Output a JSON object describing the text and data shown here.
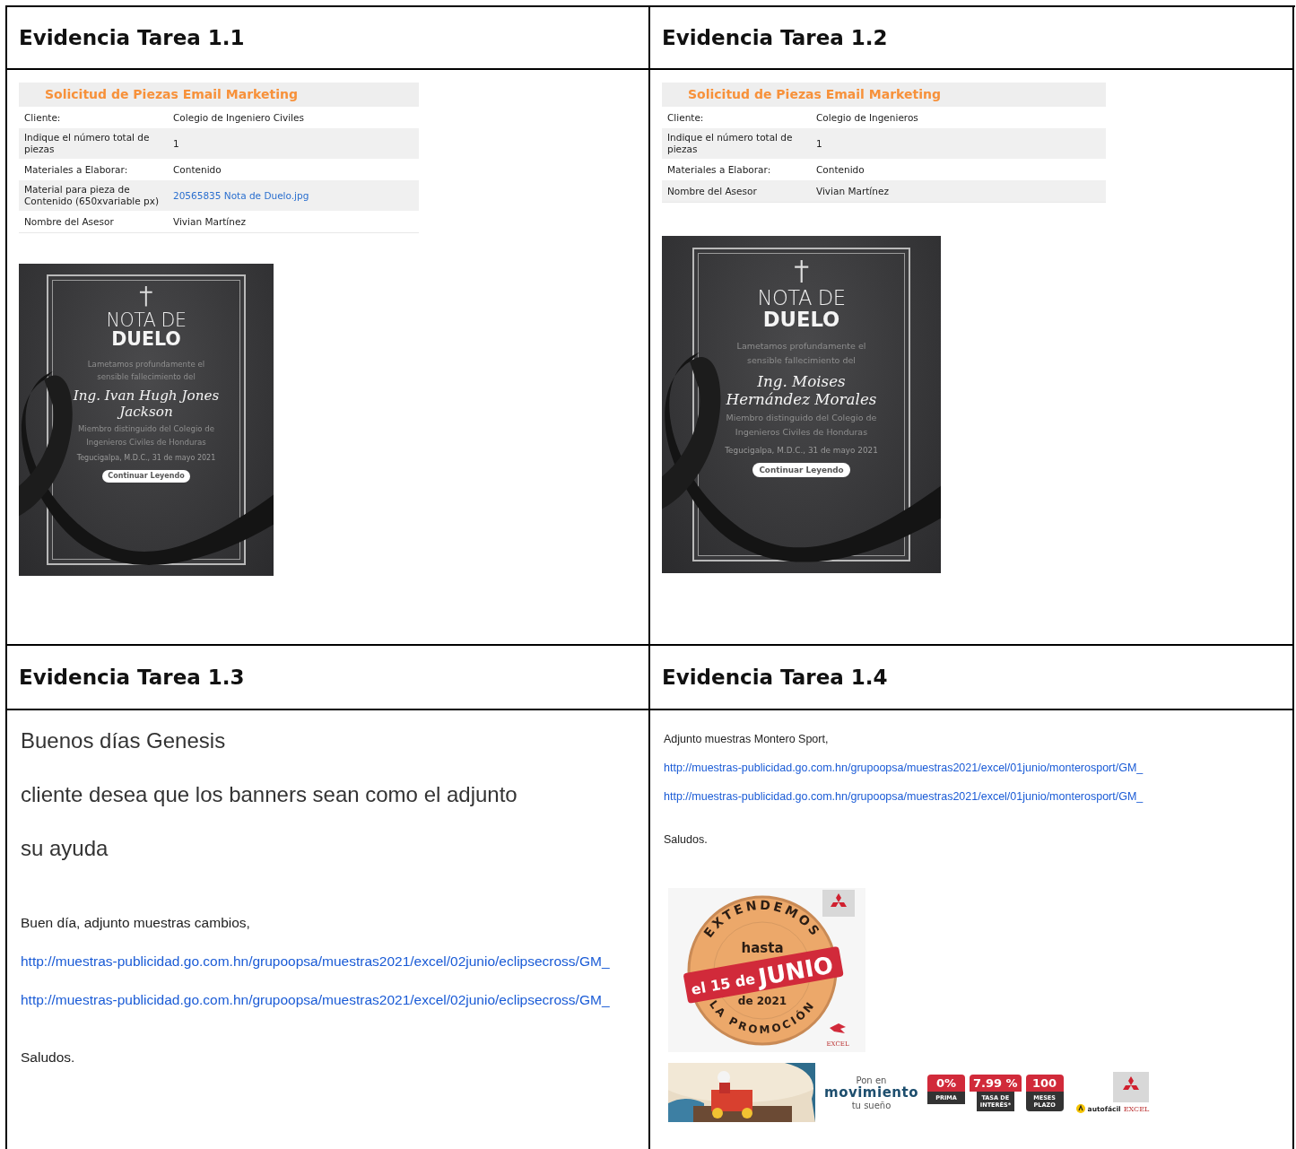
{
  "cells": [
    {
      "heading": "Evidencia Tarea 1.1",
      "blocks": [
        {
          "kind": "form",
          "title": "Solicitud de Piezas Email Marketing",
          "rows": [
            {
              "label": "Cliente:",
              "value": "Colegio de Ingeniero Civiles",
              "link": false
            },
            {
              "label": "Indique el número total de piezas",
              "value": "1",
              "link": false
            },
            {
              "label": "Materiales a Elaborar:",
              "value": "Contenido",
              "link": false
            },
            {
              "label": "Material para pieza de Contenido (650xvariable px)",
              "value": "20565835 Nota de Duelo.jpg",
              "link": true
            },
            {
              "label": "Nombre del Asesor",
              "value": "Vivian Martínez",
              "link": false
            }
          ]
        },
        {
          "kind": "card",
          "title_light": "NOTA DE",
          "title_bold": "DUELO",
          "intro": "Lametamos profundamente el sensible fallecimiento del",
          "name": "Ing. Ivan Hugh Jones Jackson",
          "member": "Miembro distinguido del Colegio de Ingenieros Civiles de Honduras",
          "date": "Tegucigalpa, M.D.C., 31 de mayo 2021",
          "button": "Continuar Leyendo"
        }
      ]
    },
    {
      "heading": "Evidencia Tarea 1.2",
      "blocks": [
        {
          "kind": "form",
          "title": "Solicitud de Piezas Email Marketing",
          "rows": [
            {
              "label": "Cliente:",
              "value": "Colegio de Ingenieros",
              "link": false
            },
            {
              "label": "Indique el número total de piezas",
              "value": "1",
              "link": false
            },
            {
              "label": "Materiales a Elaborar:",
              "value": "Contenido",
              "link": false
            },
            {
              "label": "Nombre del Asesor",
              "value": "Vivian Martínez",
              "link": false
            }
          ]
        },
        {
          "kind": "card",
          "title_light": "NOTA DE",
          "title_bold": "DUELO",
          "intro": "Lametamos profundamente el sensible fallecimiento del",
          "name": "Ing. Moises Hernández Morales",
          "member": "Miembro distinguido del Colegio de Ingenieros Civiles de Honduras",
          "date": "Tegucigalpa, M.D.C., 31 de mayo 2021",
          "button": "Continuar Leyendo"
        }
      ]
    },
    {
      "heading": "Evidencia Tarea 1.3",
      "blocks": [
        {
          "kind": "email",
          "paragraphs": [
            {
              "kind": "large",
              "text": "Buenos días Genesis"
            },
            {
              "kind": "large",
              "text": "cliente desea que los banners sean como el adjunto"
            },
            {
              "kind": "large",
              "text": "su ayuda"
            },
            {
              "kind": "text",
              "text": "Buen día, adjunto muestras cambios,"
            },
            {
              "kind": "link",
              "text": "http://muestras-publicidad.go.com.hn/grupoopsa/muestras2021/excel/02junio/eclipsecross/GM_"
            },
            {
              "kind": "link",
              "text": "http://muestras-publicidad.go.com.hn/grupoopsa/muestras2021/excel/02junio/eclipsecross/GM_"
            },
            {
              "kind": "text",
              "text": "Saludos."
            }
          ]
        }
      ]
    },
    {
      "heading": "Evidencia Tarea 1.4",
      "blocks": [
        {
          "kind": "email",
          "paragraphs": [
            {
              "kind": "text",
              "text": "Adjunto muestras Montero Sport,"
            },
            {
              "kind": "link",
              "text": "http://muestras-publicidad.go.com.hn/grupoopsa/muestras2021/excel/01junio/monterosport/GM_"
            },
            {
              "kind": "link",
              "text": "http://muestras-publicidad.go.com.hn/grupoopsa/muestras2021/excel/01junio/monterosport/GM_"
            },
            {
              "kind": "text",
              "text": "Saludos."
            }
          ]
        },
        {
          "kind": "promo",
          "arc_top": "EXTENDEMOS",
          "upper": "hasta",
          "band_small": "el 15 de",
          "band_big": "JUNIO",
          "lower": "de 2021",
          "arc_bottom": "LA PROMOCIÓN",
          "logo": "EXCEL"
        },
        {
          "kind": "banner",
          "lead": "Pon en",
          "headline": "movimiento",
          "tail": "tu sueño",
          "stats": [
            {
              "value": "0%",
              "label": "PRIMA"
            },
            {
              "value": "7.99 %",
              "label": "TASA DE INTERÉS*"
            },
            {
              "value": "100",
              "label": "MESES PLAZO"
            }
          ],
          "brand": "autofácil",
          "logo": "EXCEL"
        }
      ]
    }
  ]
}
